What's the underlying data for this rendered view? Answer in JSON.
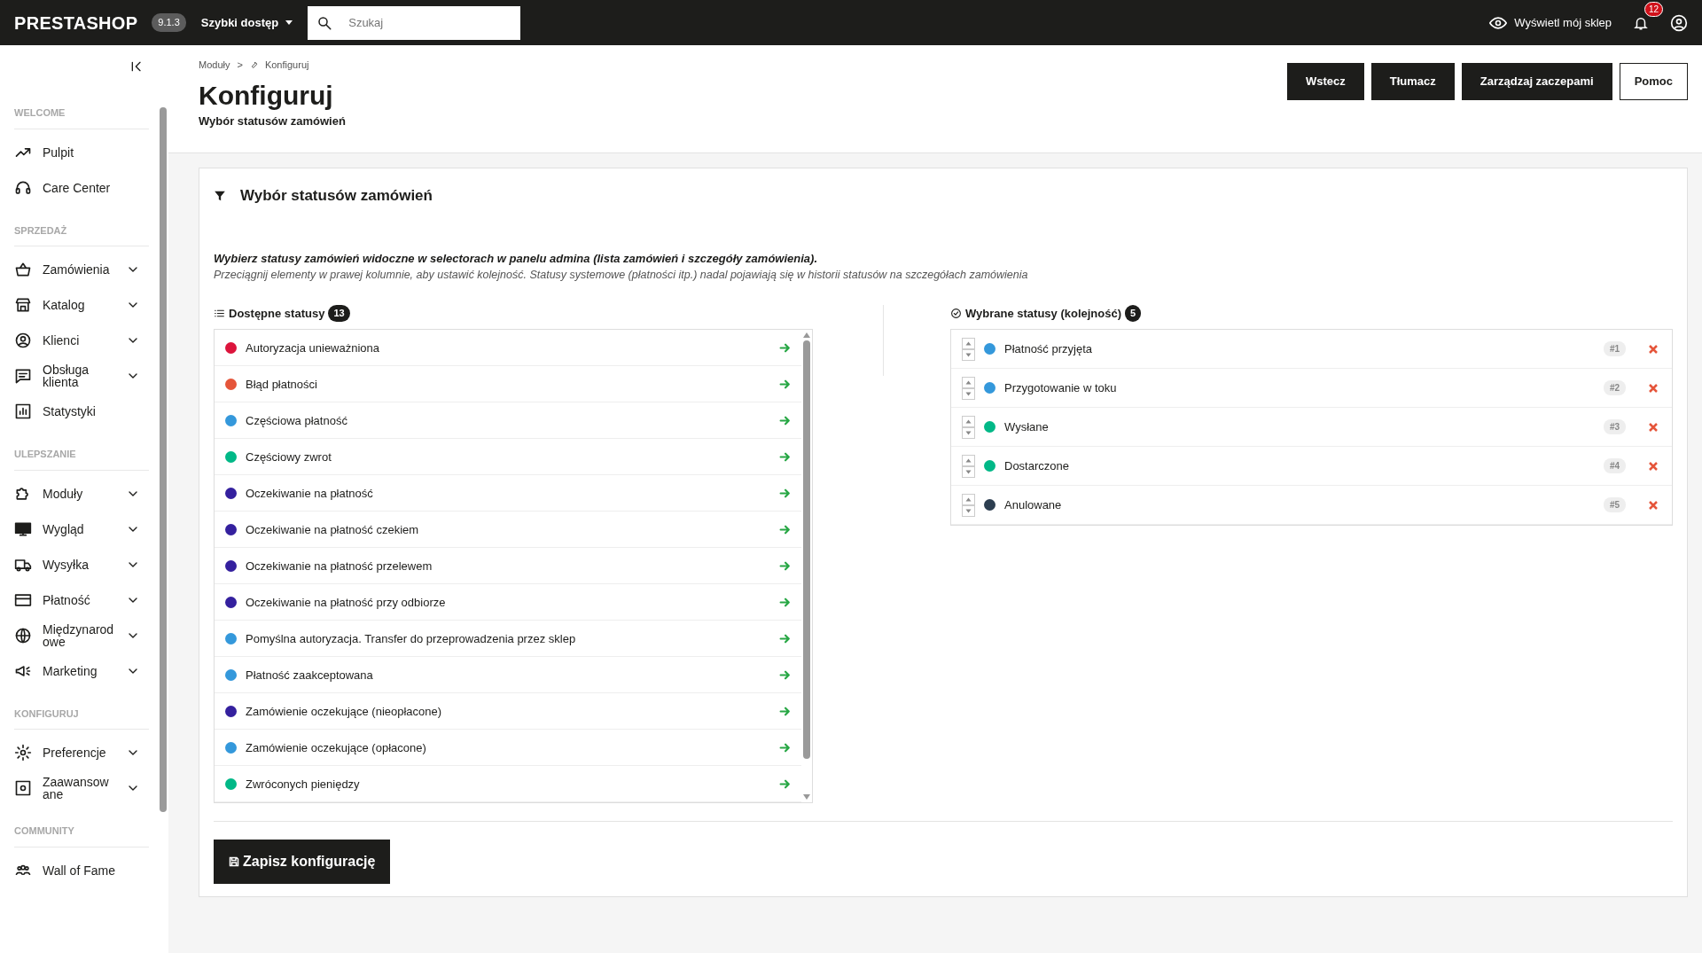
{
  "topbar": {
    "logo": "PRESTASHOP",
    "version": "9.1.3",
    "quick_access": "Szybki dostęp",
    "search": {
      "placeholder": "Szukaj"
    },
    "view_shop": "Wyświetl mój sklep",
    "notifications": "12"
  },
  "sidebar": {
    "sections": [
      {
        "title": "WELCOME",
        "items": [
          {
            "label": "Pulpit",
            "expandable": false
          },
          {
            "label": "Care Center",
            "expandable": false
          }
        ]
      },
      {
        "title": "SPRZEDAŻ",
        "items": [
          {
            "label": "Zamówienia",
            "expandable": true
          },
          {
            "label": "Katalog",
            "expandable": true
          },
          {
            "label": "Klienci",
            "expandable": true
          },
          {
            "label": "Obsługa klienta",
            "expandable": true
          },
          {
            "label": "Statystyki",
            "expandable": false
          }
        ]
      },
      {
        "title": "ULEPSZANIE",
        "items": [
          {
            "label": "Moduły",
            "expandable": true
          },
          {
            "label": "Wygląd",
            "expandable": true
          },
          {
            "label": "Wysyłka",
            "expandable": true
          },
          {
            "label": "Płatność",
            "expandable": true
          },
          {
            "label": "Międzynarodowe",
            "expandable": true
          },
          {
            "label": "Marketing",
            "expandable": true
          }
        ]
      },
      {
        "title": "KONFIGURUJ",
        "items": [
          {
            "label": "Preferencje",
            "expandable": true
          },
          {
            "label": "Zaawansowane",
            "expandable": true
          }
        ]
      },
      {
        "title": "COMMUNITY",
        "items": [
          {
            "label": "Wall of Fame",
            "expandable": false
          }
        ]
      }
    ]
  },
  "header": {
    "breadcrumb": [
      "Moduły",
      "Konfiguruj"
    ],
    "breadcrumb_separator": ">",
    "title": "Konfiguruj",
    "subtitle": "Wybór statusów zamówień",
    "buttons": [
      {
        "label": "Wstecz",
        "kind": "dark"
      },
      {
        "label": "Tłumacz",
        "kind": "dark"
      },
      {
        "label": "Zarządzaj zaczepami",
        "kind": "dark"
      },
      {
        "label": "Pomoc",
        "kind": "outline"
      }
    ]
  },
  "panel": {
    "title": "Wybór statusów zamówień",
    "intro": "Wybierz statusy zamówień widoczne w selectorach w panelu admina (lista zamówień i szczegóły zamówienia).",
    "hint": "Przeciągnij elementy w prawej kolumnie, aby ustawić kolejność. Statusy systemowe (płatności itp.) nadal pojawiają się w historii statusów na szczegółach zamówienia",
    "available": {
      "title": "Dostępne statusy",
      "count": "13",
      "items": [
        {
          "label": "Autoryzacja unieważniona",
          "color": "#dc143c"
        },
        {
          "label": "Błąd płatności",
          "color": "#e5553a"
        },
        {
          "label": "Częściowa płatność",
          "color": "#3498db"
        },
        {
          "label": "Częściowy zwrot",
          "color": "#01b887"
        },
        {
          "label": "Oczekiwanie na płatność",
          "color": "#34209e"
        },
        {
          "label": "Oczekiwanie na płatność czekiem",
          "color": "#34209e"
        },
        {
          "label": "Oczekiwanie na płatność przelewem",
          "color": "#34209e"
        },
        {
          "label": "Oczekiwanie na płatność przy odbiorze",
          "color": "#34209e"
        },
        {
          "label": "Pomyślna autoryzacja. Transfer do przeprowadzenia przez sklep",
          "color": "#3498db"
        },
        {
          "label": "Płatność zaakceptowana",
          "color": "#3498db"
        },
        {
          "label": "Zamówienie oczekujące (nieopłacone)",
          "color": "#34209e"
        },
        {
          "label": "Zamówienie oczekujące (opłacone)",
          "color": "#3498db"
        },
        {
          "label": "Zwróconych pieniędzy",
          "color": "#01b887"
        }
      ]
    },
    "selected": {
      "title": "Wybrane statusy (kolejność)",
      "count": "5",
      "items": [
        {
          "label": "Płatność przyjęta",
          "color": "#3498db",
          "position": "#1"
        },
        {
          "label": "Przygotowanie w toku",
          "color": "#3498db",
          "position": "#2"
        },
        {
          "label": "Wysłane",
          "color": "#01b887",
          "position": "#3"
        },
        {
          "label": "Dostarczone",
          "color": "#01b887",
          "position": "#4"
        },
        {
          "label": "Anulowane",
          "color": "#2c3e50",
          "position": "#5"
        }
      ]
    },
    "save_button": "Zapisz konfigurację"
  }
}
